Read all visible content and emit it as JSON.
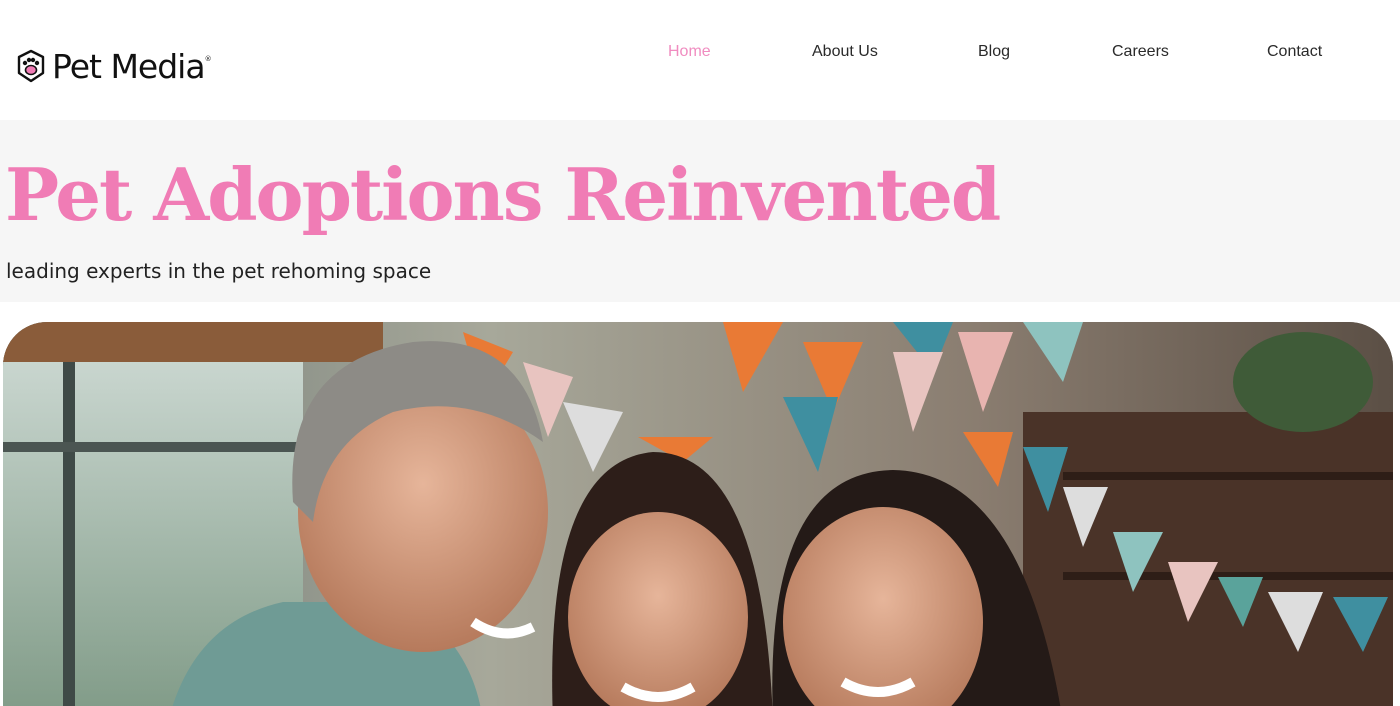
{
  "brand": {
    "name": "Pet Media",
    "logo_icon": "paw-shield-icon",
    "registered_mark": "®"
  },
  "nav": {
    "items": [
      {
        "label": "Home",
        "active": true
      },
      {
        "label": "About Us",
        "active": false
      },
      {
        "label": "Blog",
        "active": false
      },
      {
        "label": "Careers",
        "active": false
      },
      {
        "label": "Contact",
        "active": false
      }
    ]
  },
  "hero": {
    "title": "Pet Adoptions Reinvented",
    "subtitle": "leading experts in the pet rehoming space"
  },
  "colors": {
    "accent_pink": "#f07cb5",
    "nav_active": "#f08cc0",
    "hero_band": "#f6f6f6",
    "text_dark": "#222222"
  }
}
